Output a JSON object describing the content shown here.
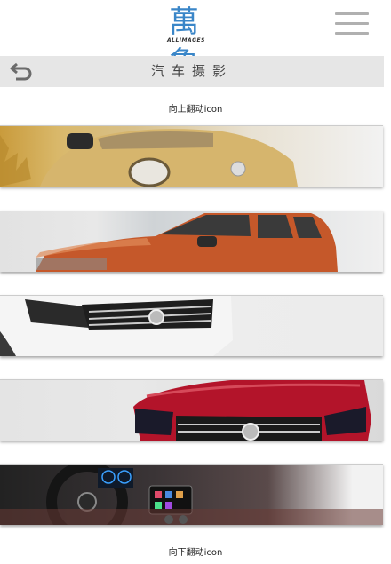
{
  "header": {
    "logo_text": "萬象",
    "logo_sub": "ALLIMAGES"
  },
  "titlebar": {
    "title": "汽车摄影"
  },
  "hints": {
    "up": "向上翻动icon",
    "down": "向下翻动icon"
  },
  "banners": [
    {
      "icon": "car-photo-yellow-beetle",
      "accent": "#c99b3c"
    },
    {
      "icon": "car-photo-orange-suv",
      "accent": "#c7522a"
    },
    {
      "icon": "car-photo-white-suv-front",
      "accent": "#e8e8e8"
    },
    {
      "icon": "car-photo-red-suv-front",
      "accent": "#b01a2a"
    },
    {
      "icon": "car-photo-interior-dashboard",
      "accent": "#2a2628"
    }
  ]
}
